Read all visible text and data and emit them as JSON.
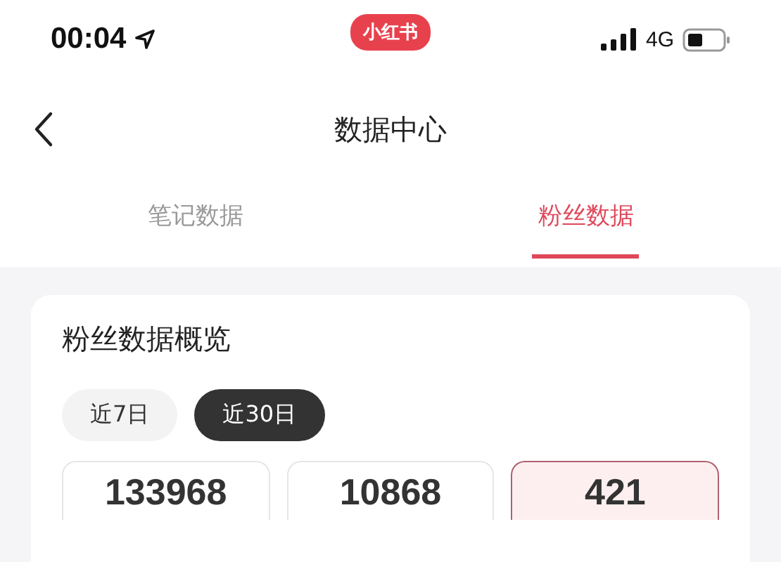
{
  "status_bar": {
    "time": "00:04",
    "app_badge": "小红书",
    "network": "4G"
  },
  "nav": {
    "title": "数据中心"
  },
  "tabs": [
    {
      "label": "笔记数据",
      "selected": false
    },
    {
      "label": "粉丝数据",
      "selected": true
    }
  ],
  "card": {
    "title": "粉丝数据概览",
    "ranges": [
      {
        "label": "近7日",
        "selected": false
      },
      {
        "label": "近30日",
        "selected": true
      }
    ],
    "stats": [
      {
        "value": "133968",
        "selected": false
      },
      {
        "value": "10868",
        "selected": false
      },
      {
        "value": "421",
        "selected": true
      }
    ]
  }
}
